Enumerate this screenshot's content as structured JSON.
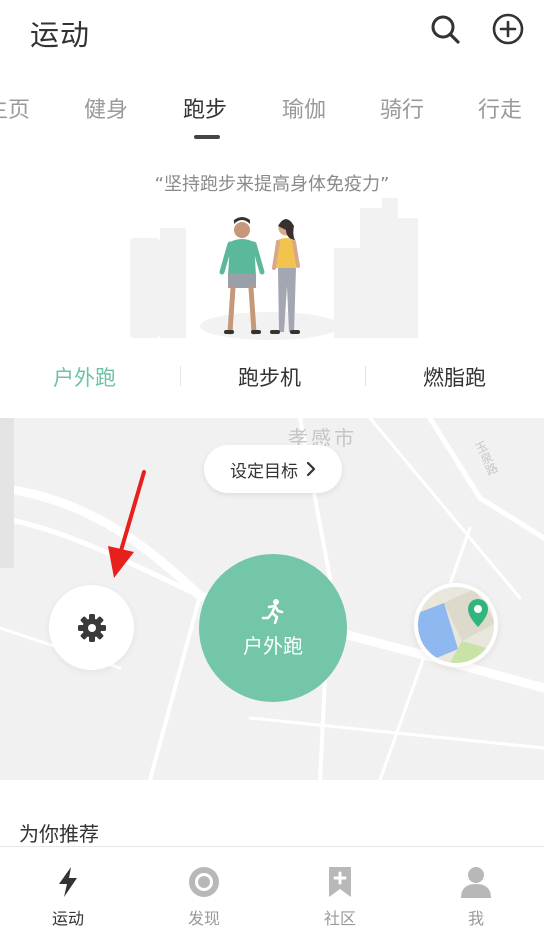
{
  "header": {
    "title": "运动",
    "search_icon": "search-icon",
    "add_icon": "add-circle-icon"
  },
  "tabs": [
    {
      "label": "主页",
      "active": false
    },
    {
      "label": "健身",
      "active": false
    },
    {
      "label": "跑步",
      "active": true
    },
    {
      "label": "瑜伽",
      "active": false
    },
    {
      "label": "骑行",
      "active": false
    },
    {
      "label": "行走",
      "active": false
    }
  ],
  "hero": {
    "quote": "“坚持跑步来提高身体免疫力”"
  },
  "modes": [
    {
      "label": "户外跑",
      "active": true
    },
    {
      "label": "跑步机",
      "active": false
    },
    {
      "label": "燃脂跑",
      "active": false
    }
  ],
  "map": {
    "city_label": "孝感市",
    "road_label": "玉泉路",
    "goal_button": "设定目标",
    "start_button": "户外跑",
    "settings_icon": "gear-icon",
    "map_icon": "map-location-icon"
  },
  "recommend": {
    "title": "为你推荐"
  },
  "bottom_nav": [
    {
      "label": "运动",
      "icon": "lightning-icon",
      "active": true
    },
    {
      "label": "发现",
      "icon": "discover-icon",
      "active": false
    },
    {
      "label": "社区",
      "icon": "bookmark-plus-icon",
      "active": false
    },
    {
      "label": "我",
      "icon": "user-icon",
      "active": false
    }
  ],
  "colors": {
    "accent": "#73c6a8",
    "map_bg": "#f1f1f1",
    "annotation_arrow": "#e8201d"
  }
}
